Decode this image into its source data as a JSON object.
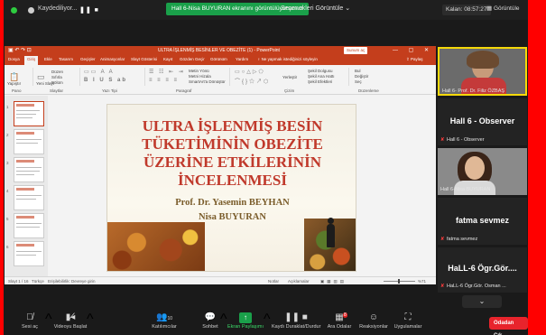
{
  "topbar": {
    "recording_label": "Kaydediliyor...",
    "pause_icon": "pause-icon",
    "share_banner": "Hall 6-Nisa BUYURAN ekranını görüntülüyorsunuz",
    "view_options": "Seçenekleri Görüntüle",
    "view_options_icon": "chevron-down-icon",
    "clock": "Kalan: 08:57:27",
    "view_button": "Görüntüle"
  },
  "ppt": {
    "doc_title": "ULTRA İŞLENMİŞ BESİNLER VE OBEZİTE (1) - PowerPoint",
    "share_button": "Sunum aç",
    "tabs": [
      "Dosya",
      "Giriş",
      "Ekle",
      "Tasarım",
      "Geçişler",
      "Animasyonlar",
      "Slayt Gösterisi",
      "Kayıt",
      "Gözden Geçir",
      "Görünüm",
      "Yardım"
    ],
    "tell_me": "Ne yapmak istediğinizi söyleyin",
    "share_tab": "Paylaş",
    "ribbon": {
      "paste": "Yapıştır",
      "new_slide": "Yeni Slayt",
      "layout": "Düzen",
      "reset": "Sıfırla",
      "section": "Bölüm",
      "group_clipboard": "Pano",
      "group_slides": "Slaytlar",
      "group_font": "Yazı Tipi",
      "group_paragraph": "Paragraf",
      "group_drawing": "Çizim",
      "group_editing": "Düzenleme",
      "text_direction": "Metin Yönü",
      "align_text": "Metni Hizala",
      "smartart": "SmartArt'a Dönüştür",
      "arrange": "Yerleştir",
      "shape_fill": "Şekil Dolgusu",
      "shape_outline": "Şekil Ana Hattı",
      "shape_effects": "Şekil Efektleri",
      "find": "Bul",
      "replace": "Değiştir",
      "select": "Seç"
    },
    "thumbs": [
      "1",
      "2",
      "3",
      "4",
      "5",
      "6"
    ],
    "slide": {
      "title_lines": [
        "ULTRA İŞLENMİŞ BESİN",
        "TÜKETİMİNİN OBEZİTE",
        "ÜZERİNE ETKİLERİNİN",
        "İNCELENMESİ"
      ],
      "author1": "Prof. Dr. Yasemin BEYHAN",
      "author2": "Nisa BUYURAN"
    },
    "status": {
      "slide_no": "Slayt 1 / 16",
      "language": "Türkçe",
      "accessibility": "Erişilebilirlik: Devreye girin",
      "notes": "Notlar",
      "comments": "Açıklamalar",
      "zoom": "%71"
    }
  },
  "participants": [
    {
      "label": "Hall 6- Prof. Dr. Filiz ÖZBAŞ",
      "type": "video",
      "active": true
    },
    {
      "big": "Hall 6 - Observer",
      "label": "Hall 6 - Observer",
      "type": "name"
    },
    {
      "label": "Hall 6-Nisa BUYURAN",
      "type": "video"
    },
    {
      "big": "fatma sevmez",
      "label": "fatma sevmez",
      "type": "name"
    },
    {
      "big": "HaLL-6 Ögr.Gör....",
      "label": "HaLL-6 Ögr.Gör. Osman ...",
      "type": "name"
    }
  ],
  "bottom": {
    "mute": "Sesi aç",
    "video": "Videoyu Başlat",
    "participants": "Katılımcılar",
    "participants_count": "10",
    "chat": "Sohbet",
    "share": "Ekran Paylaşımı",
    "record": "Kaydı Duraklat/Durdur",
    "breakout": "Ara Odalar",
    "reactions": "Reaksiyonlar",
    "apps": "Uygulamalar",
    "badge": "8",
    "leave": "Odadan Çık"
  },
  "colors": {
    "ppt_accent": "#c43e1c",
    "zoom_green": "#1aa04a",
    "leave_red": "#e8242c",
    "active_speaker": "#f5d90a",
    "slide_title": "#c0392b"
  }
}
